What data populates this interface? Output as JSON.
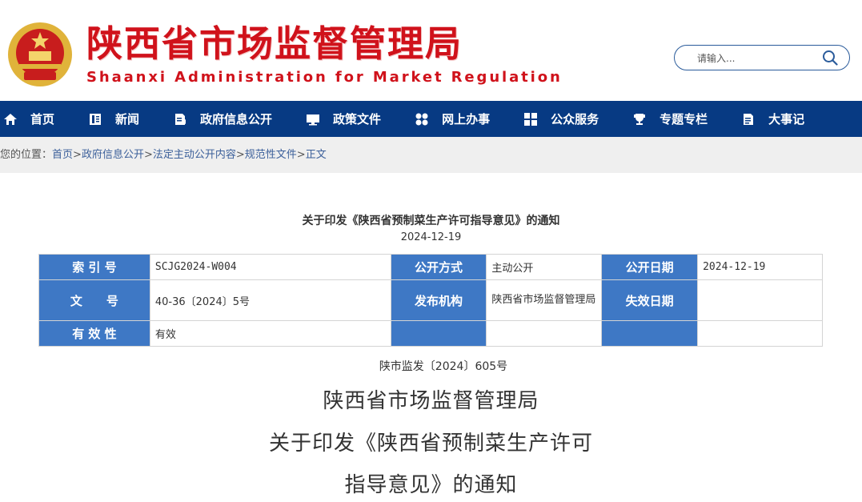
{
  "header": {
    "title_cn": "陕西省市场监督管理局",
    "title_en": "Shaanxi Administration for Market Regulation",
    "brand_color": "#d0121b"
  },
  "search": {
    "placeholder": "请输入..."
  },
  "nav": {
    "bg_color": "#073a83",
    "items": [
      {
        "label": "首页",
        "icon": "home-icon"
      },
      {
        "label": "新闻",
        "icon": "news-icon"
      },
      {
        "label": "政府信息公开",
        "icon": "info-icon"
      },
      {
        "label": "政策文件",
        "icon": "monitor-icon"
      },
      {
        "label": "网上办事",
        "icon": "clover-icon"
      },
      {
        "label": "公众服务",
        "icon": "grid-icon"
      },
      {
        "label": "专题专栏",
        "icon": "trophy-icon"
      },
      {
        "label": "大事记",
        "icon": "document-icon"
      }
    ]
  },
  "breadcrumb": {
    "prefix": "您的位置：",
    "items": [
      "首页",
      "政府信息公开",
      "法定主动公开内容",
      "规范性文件",
      "正文"
    ],
    "sep": ">"
  },
  "document": {
    "title": "关于印发《陕西省预制菜生产许可指导意见》的通知",
    "date": "2024-12-19",
    "meta": {
      "index_label": "索 引 号",
      "index_value": "SCJG2024-W004",
      "open_mode_label": "公开方式",
      "open_mode_value": "主动公开",
      "open_date_label": "公开日期",
      "open_date_value": "2024-12-19",
      "doc_no_label": "文　　号",
      "doc_no_value": "40-36〔2024〕5号",
      "publisher_label": "发布机构",
      "publisher_value": "陕西省市场监督管理局",
      "expiry_label": "失效日期",
      "expiry_value": "",
      "validity_label": "有 效 性",
      "validity_value": "有效"
    },
    "doc_number": "陕市监发〔2024〕605号",
    "heading_lines": [
      "陕西省市场监督管理局",
      "关于印发《陕西省预制菜生产许可",
      "指导意见》的通知"
    ],
    "header_cell_color": "#3e78c5"
  }
}
